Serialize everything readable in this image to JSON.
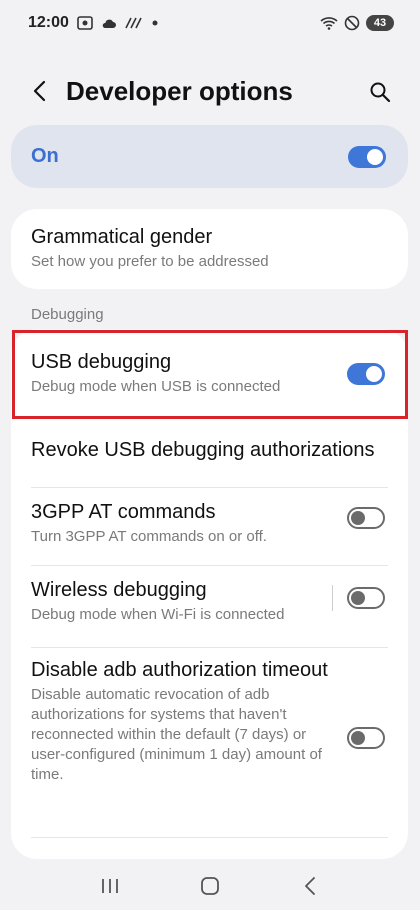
{
  "status_bar": {
    "time": "12:00",
    "battery": "43",
    "icons": [
      "screenshot-icon",
      "cloud-icon",
      "signal-icon",
      "dot-icon",
      "wifi-icon",
      "do-not-disturb-icon",
      "battery-icon"
    ]
  },
  "header": {
    "title": "Developer options",
    "back_icon": "back-arrow-icon",
    "search_icon": "search-icon"
  },
  "master_switch": {
    "label": "On",
    "state": "on"
  },
  "gender": {
    "title": "Grammatical gender",
    "subtitle": "Set how you prefer to be addressed"
  },
  "debugging": {
    "section_label": "Debugging",
    "items": [
      {
        "title": "USB debugging",
        "subtitle": "Debug mode when USB is connected",
        "toggle": "on"
      },
      {
        "title": "Revoke USB debugging authorizations",
        "subtitle": ""
      },
      {
        "title": "3GPP AT commands",
        "subtitle": "Turn 3GPP AT commands on or off.",
        "toggle": "off"
      },
      {
        "title": "Wireless debugging",
        "subtitle": "Debug mode when Wi-Fi is connected",
        "toggle": "off"
      },
      {
        "title": "Disable adb authorization timeout",
        "subtitle": "Disable automatic revocation of adb authorizations for systems that haven't reconnected within the default (7 days) or user-configured (minimum 1 day) amount of time.",
        "toggle": "off"
      }
    ]
  },
  "colors": {
    "accent": "#3f77d8",
    "highlight": "#d9232b",
    "background": "#f2f2f4"
  },
  "navbar": {
    "icons": [
      "recents-icon",
      "home-icon",
      "back-nav-icon"
    ]
  }
}
